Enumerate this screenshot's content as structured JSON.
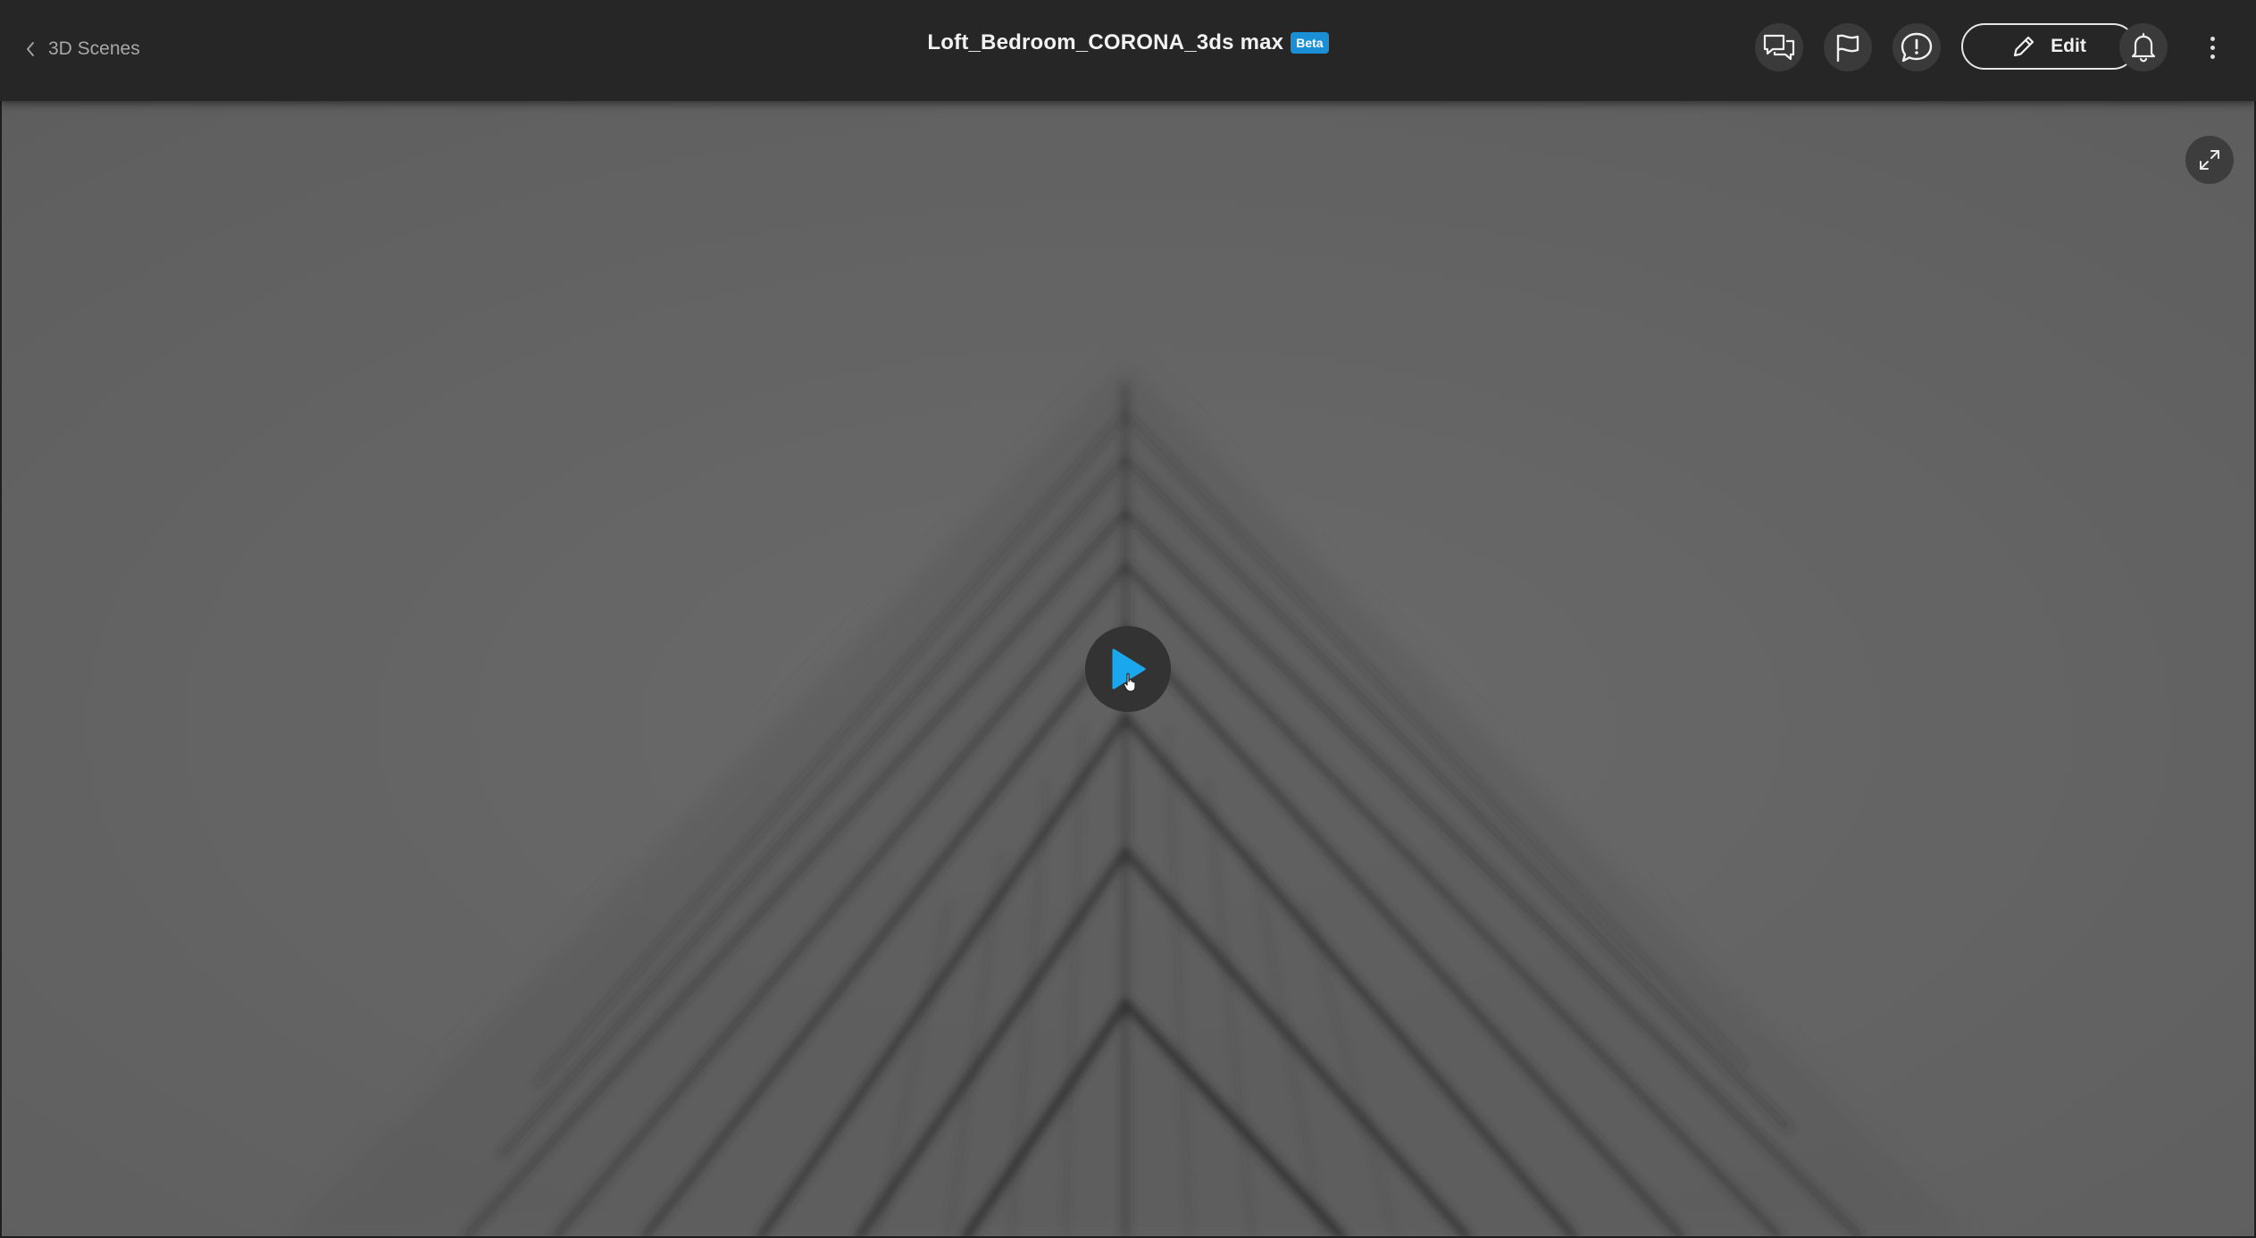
{
  "header": {
    "back_label": "3D Scenes",
    "title": "Loft_Bedroom_CORONA_3ds max",
    "badge": "Beta",
    "edit_label": "Edit",
    "icons": [
      "comments-icon",
      "flag-icon",
      "alert-circle-icon",
      "pencil-icon",
      "bell-icon",
      "more-vertical-icon"
    ]
  },
  "viewer": {
    "controls": [
      "play-icon",
      "fullscreen-icon"
    ]
  },
  "colors": {
    "topbar": "#262626",
    "viewer_background": "#666666",
    "beta_badge": "#1a8fd6",
    "play_accent": "#1aa7ee"
  }
}
